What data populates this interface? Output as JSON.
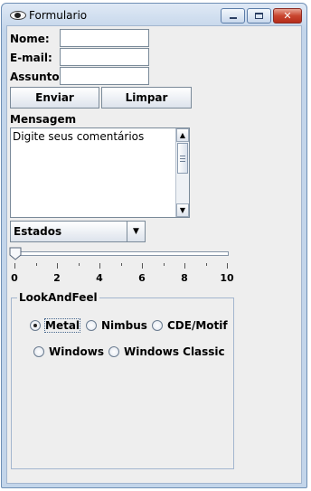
{
  "window": {
    "title": "Formulario",
    "close_glyph": "✕"
  },
  "form": {
    "name_label": "Nome:",
    "email_label": "E-mail:",
    "subject_label": "Assunto:",
    "name_value": "",
    "email_value": "",
    "subject_value": ""
  },
  "buttons": {
    "send": "Enviar",
    "clear": "Limpar"
  },
  "message": {
    "label": "Mensagem",
    "text": "Digite seus comentários"
  },
  "states_combo": {
    "selected": "Estados"
  },
  "slider": {
    "min": 0,
    "max": 10,
    "value": 0,
    "ticks": [
      "0",
      "2",
      "4",
      "6",
      "8",
      "10"
    ]
  },
  "lookandfeel": {
    "title": "LookAndFeel",
    "options": [
      "Metal",
      "Nimbus",
      "CDE/Motif",
      "Windows",
      "Windows Classic"
    ],
    "selected": "Metal"
  }
}
